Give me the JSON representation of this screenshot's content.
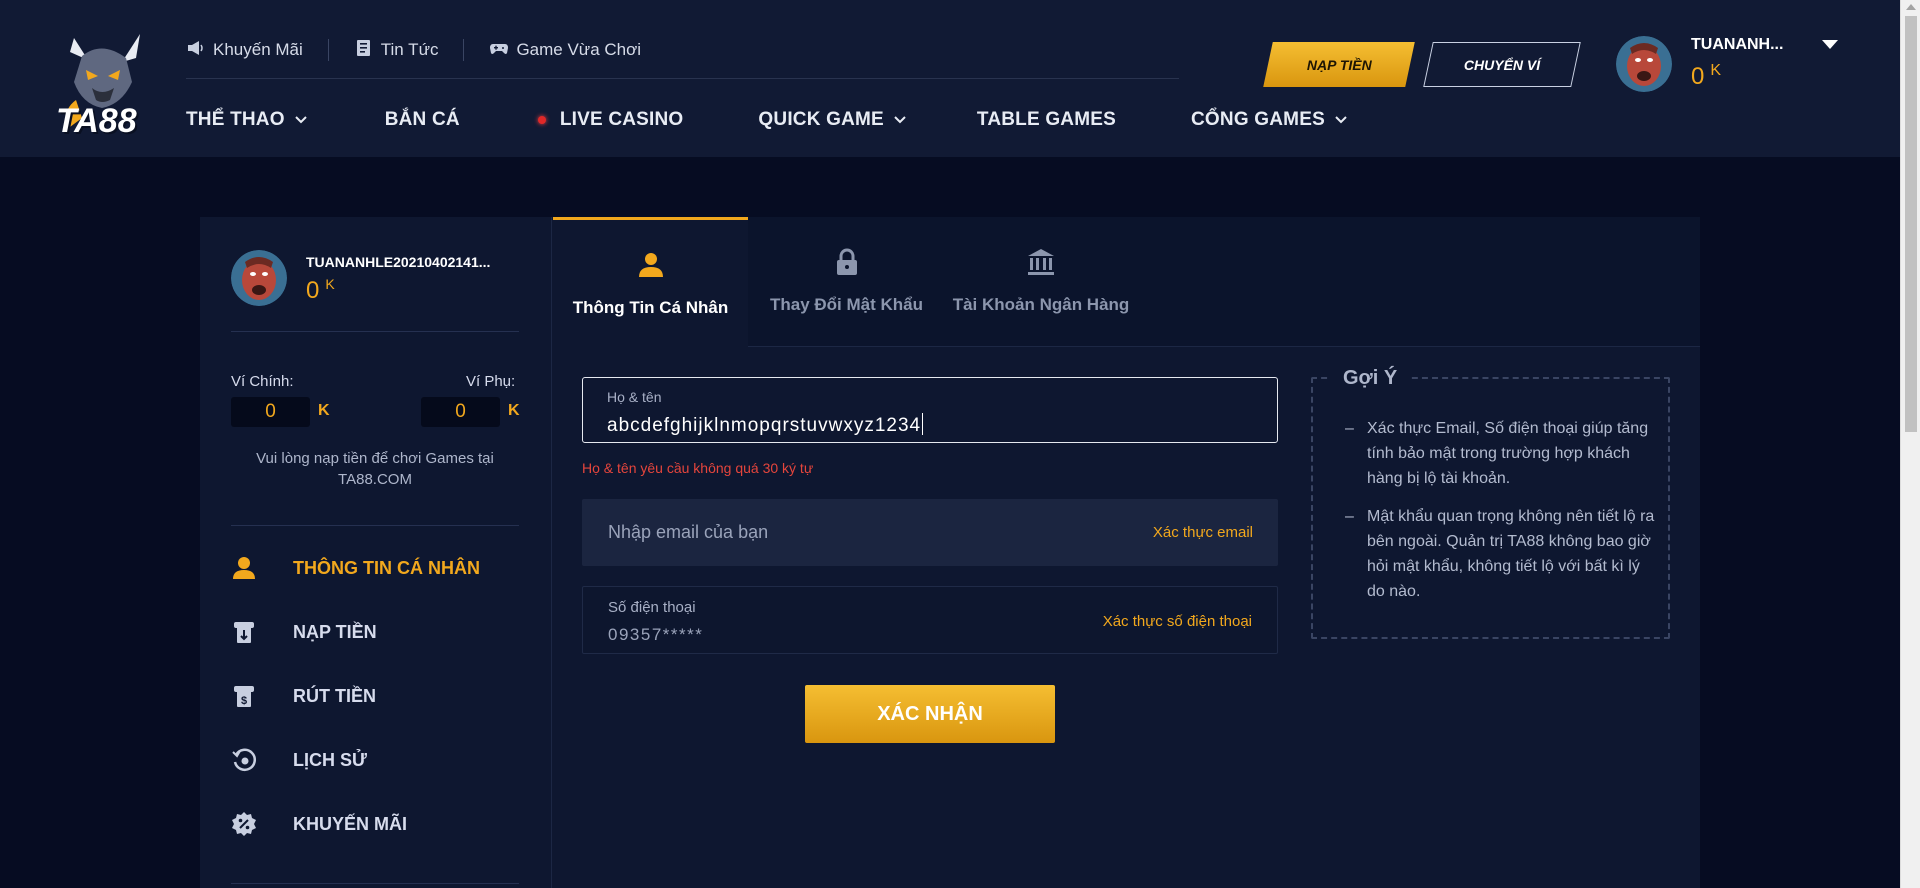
{
  "header": {
    "logo_text": "TA88",
    "top_links": [
      {
        "label": "Khuyến Mãi",
        "icon": "megaphone-icon"
      },
      {
        "label": "Tin Tức",
        "icon": "news-icon"
      },
      {
        "label": "Game Vừa Chơi",
        "icon": "gamepad-icon"
      }
    ],
    "nav": {
      "sports": "THỂ THAO",
      "fishing": "BẮN CÁ",
      "live_casino": "LIVE CASINO",
      "quick_game": "QUICK GAME",
      "table_games": "TABLE GAMES",
      "game_portal": "CỔNG GAMES"
    },
    "deposit_button": "NẠP TIỀN",
    "transfer_button": "CHUYỂN VÍ",
    "username": "TUANANH...",
    "balance": "0",
    "balance_unit": "K"
  },
  "sidebar": {
    "username": "TUANANHLE20210402141...",
    "balance": "0",
    "balance_unit": "K",
    "main_wallet_label": "Ví Chính:",
    "main_wallet_value": "0",
    "sub_wallet_label": "Ví Phụ:",
    "sub_wallet_value": "0",
    "wallet_unit": "K",
    "note": "Vui lòng nạp tiền để chơi Games tại TA88.COM",
    "menu": [
      {
        "label": "THÔNG TIN CÁ NHÂN",
        "icon": "user-icon",
        "active": true
      },
      {
        "label": "NẠP TIỀN",
        "icon": "deposit-icon",
        "active": false
      },
      {
        "label": "RÚT TIỀN",
        "icon": "withdraw-icon",
        "active": false
      },
      {
        "label": "LỊCH SỬ",
        "icon": "history-icon",
        "active": false
      },
      {
        "label": "KHUYẾN MÃI",
        "icon": "promotion-icon",
        "active": false
      }
    ]
  },
  "tabs": [
    {
      "label": "Thông Tin Cá Nhân",
      "icon": "user-icon",
      "active": true
    },
    {
      "label": "Thay Đổi Mật Khẩu",
      "icon": "lock-icon",
      "active": false
    },
    {
      "label": "Tài Khoản Ngân Hàng",
      "icon": "bank-icon",
      "active": false
    }
  ],
  "form": {
    "name_label": "Họ & tên",
    "name_value": "abcdefghijklnmopqrstuvwxyz1234",
    "name_error": "Họ & tên yêu cầu không quá 30 ký tự",
    "email_placeholder": "Nhập email của bạn",
    "email_verify": "Xác thực email",
    "phone_label": "Số điện thoại",
    "phone_value": "09357*****",
    "phone_verify": "Xác thực số điện thoại",
    "submit": "XÁC NHẬN"
  },
  "hint": {
    "title": "Gợi Ý",
    "items": [
      "Xác thực Email, Số điện thoại giúp tăng tính bảo mật trong trường hợp khách hàng bị lộ tài khoản.",
      "Mật khẩu quan trọng không nên tiết lộ ra bên ngoài. Quản trị TA88 không bao giờ hỏi mật khẩu, không tiết lộ với bất kì lý do nào."
    ]
  },
  "colors": {
    "accent": "#f2a81d",
    "header_bg": "#111a34",
    "page_bg": "#060c22",
    "panel_bg": "#0e1730",
    "error": "#e5453c"
  }
}
